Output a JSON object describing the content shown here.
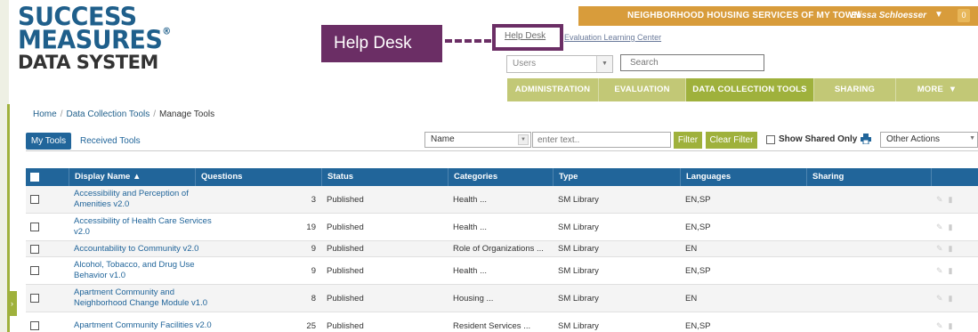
{
  "logo": {
    "line1": "SUCCESS",
    "line2": "MEASURES",
    "reg": "®",
    "line3": "DATA SYSTEM"
  },
  "callout": {
    "label": "Help Desk"
  },
  "top_links": {
    "help_desk": "Help Desk",
    "learning_center": "Evaluation Learning Center"
  },
  "org_bar": {
    "org_name": "NEIGHBORHOOD HOUSING SERVICES OF MY TOWN",
    "user_name": "Elissa Schloesser",
    "notification_count": "0"
  },
  "search": {
    "scope_value": "Users",
    "placeholder": "Search"
  },
  "nav": [
    {
      "label": "ADMINISTRATION",
      "active": false
    },
    {
      "label": "EVALUATION",
      "active": false
    },
    {
      "label": "DATA COLLECTION TOOLS",
      "active": true
    },
    {
      "label": "SHARING",
      "active": false
    },
    {
      "label": "MORE",
      "active": false
    }
  ],
  "breadcrumb": {
    "home": "Home",
    "section": "Data Collection Tools",
    "current": "Manage Tools"
  },
  "tabs": {
    "my_tools": "My Tools",
    "received_tools": "Received Tools"
  },
  "filters": {
    "field_value": "Name",
    "text_placeholder": "enter text..",
    "filter_label": "Filter",
    "clear_label": "Clear Filter",
    "shared_only_label": "Show Shared Only",
    "other_actions_value": "Other Actions"
  },
  "table": {
    "headers": {
      "display_name": "Display Name",
      "questions": "Questions",
      "status": "Status",
      "categories": "Categories",
      "type": "Type",
      "languages": "Languages",
      "sharing": "Sharing"
    },
    "rows": [
      {
        "name": "Accessibility and Perception of Amenities v2.0",
        "questions": "3",
        "status": "Published",
        "categories": "Health ...",
        "type": "SM Library",
        "languages": "EN,SP"
      },
      {
        "name": "Accessibility of Health Care Services v2.0",
        "questions": "19",
        "status": "Published",
        "categories": "Health ...",
        "type": "SM Library",
        "languages": "EN,SP"
      },
      {
        "name": "Accountability to Community v2.0",
        "questions": "9",
        "status": "Published",
        "categories": "Role of Organizations ...",
        "type": "SM Library",
        "languages": "EN"
      },
      {
        "name": "Alcohol, Tobacco, and Drug Use Behavior v1.0",
        "questions": "9",
        "status": "Published",
        "categories": "Health ...",
        "type": "SM Library",
        "languages": "EN,SP"
      },
      {
        "name": "Apartment Community and Neighborhood Change Module v1.0",
        "questions": "8",
        "status": "Published",
        "categories": "Housing ...",
        "type": "SM Library",
        "languages": "EN"
      },
      {
        "name": "Apartment Community Facilities v2.0",
        "questions": "25",
        "status": "Published",
        "categories": "Resident Services ...",
        "type": "SM Library",
        "languages": "EN,SP"
      }
    ]
  }
}
